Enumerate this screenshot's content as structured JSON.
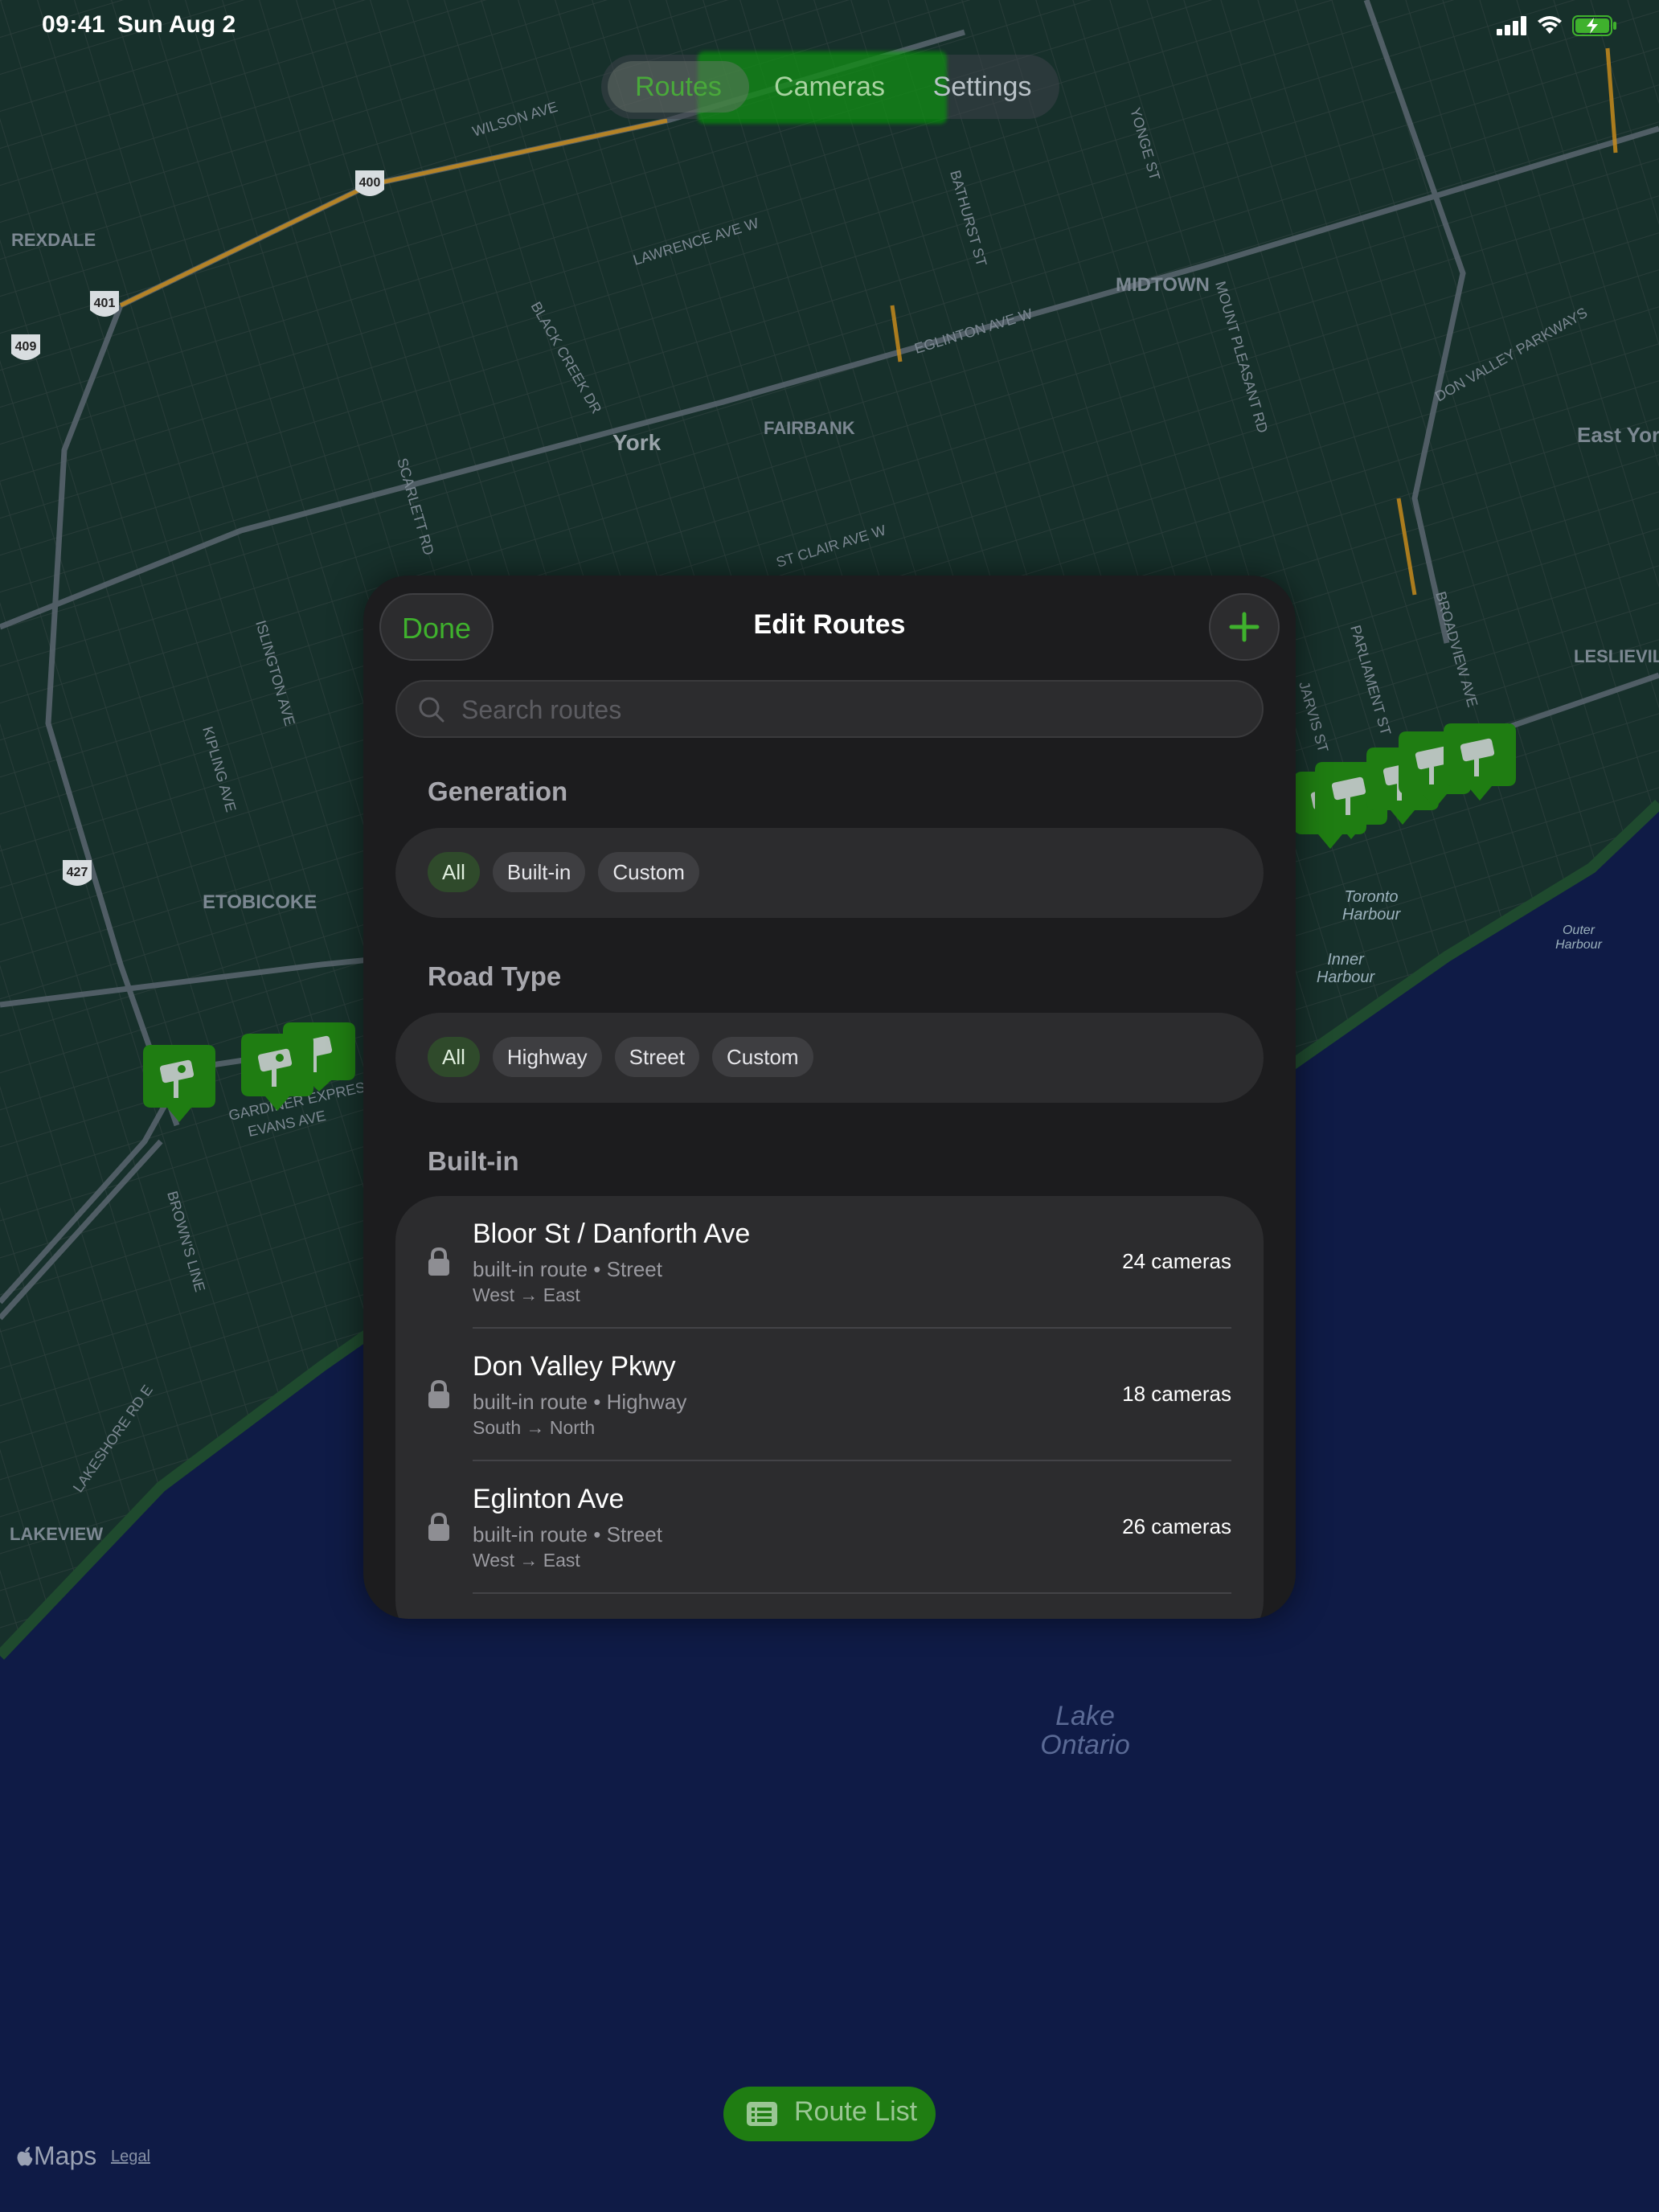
{
  "status_bar": {
    "time": "09:41",
    "date": "Sun Aug 2",
    "icons": [
      "cellular-signal-icon",
      "wifi-icon",
      "battery-charging-icon"
    ]
  },
  "segmented_control": {
    "items": [
      "Routes",
      "Cameras",
      "Settings"
    ],
    "selected": "Routes"
  },
  "map": {
    "labels": {
      "rexdale": "REXDALE",
      "york": "York",
      "fairbank": "FAIRBANK",
      "midtown": "MIDTOWN",
      "etobicoke": "ETOBICOKE",
      "lakeview": "LAKEVIEW",
      "leslieville": "LESLIEVILLE",
      "east_york": "East Yor",
      "toronto_harbour_1": "Toronto",
      "toronto_harbour_2": "Harbour",
      "inner_harbour_1": "Inner",
      "inner_harbour_2": "Harbour",
      "outer_harbour_1": "Outer",
      "outer_harbour_2": "Harbour",
      "lake_1": "Lake",
      "lake_2": "Ontario",
      "wilson": "WILSON AVE",
      "lawrence": "LAWRENCE AVE W",
      "eglinton": "EGLINTON AVE W",
      "st_clair": "ST CLAIR AVE W",
      "gardiner": "GARDINER EXPRESS",
      "evans": "EVANS AVE",
      "kipling": "KIPLING AVE",
      "islington": "ISLINGTON AVE",
      "black_creek": "BLACK CREEK DR",
      "scarlett": "SCARLETT RD",
      "bathurst": "BATHURST ST",
      "yonge": "YONGE ST",
      "mount_pleasant": "MOUNT PLEASANT RD",
      "don_valley": "DON VALLEY PARKWAYS",
      "browns_line": "BROWN'S LINE",
      "lakeshore": "LAKESHORE RD E",
      "parliament": "PARLIAMENT ST",
      "jarvis": "JARVIS ST",
      "broadview": "BROADVIEW AVE",
      "highway_400": "400",
      "highway_401": "401",
      "highway_409": "409",
      "highway_427": "427"
    },
    "attribution": {
      "logo": "Maps",
      "legal": "Legal"
    }
  },
  "sheet": {
    "title": "Edit Routes",
    "done_label": "Done",
    "add_icon": "plus-icon",
    "search": {
      "placeholder": "Search routes",
      "value": ""
    },
    "generation": {
      "header": "Generation",
      "options": [
        "All",
        "Built-in",
        "Custom"
      ],
      "selected": "All"
    },
    "road_type": {
      "header": "Road Type",
      "options": [
        "All",
        "Highway",
        "Street",
        "Custom"
      ],
      "selected": "All"
    },
    "builtin": {
      "header": "Built-in",
      "routes": [
        {
          "name": "Bloor St / Danforth Ave",
          "subtitle": "built-in route • Street",
          "direction": "West → East",
          "cameras": "24 cameras"
        },
        {
          "name": "Don Valley Pkwy",
          "subtitle": "built-in route • Highway",
          "direction": "South → North",
          "cameras": "18 cameras"
        },
        {
          "name": "Eglinton Ave",
          "subtitle": "built-in route • Street",
          "direction": "West → East",
          "cameras": "26 cameras"
        }
      ]
    }
  },
  "route_list_button": {
    "label": "Route List",
    "icon": "list-icon"
  },
  "colors": {
    "accent": "#3fb12d",
    "sheet_bg": "#1c1c1e",
    "card_bg": "#2c2c2e",
    "map_water": "#0f1b46",
    "map_land": "#16302a"
  }
}
